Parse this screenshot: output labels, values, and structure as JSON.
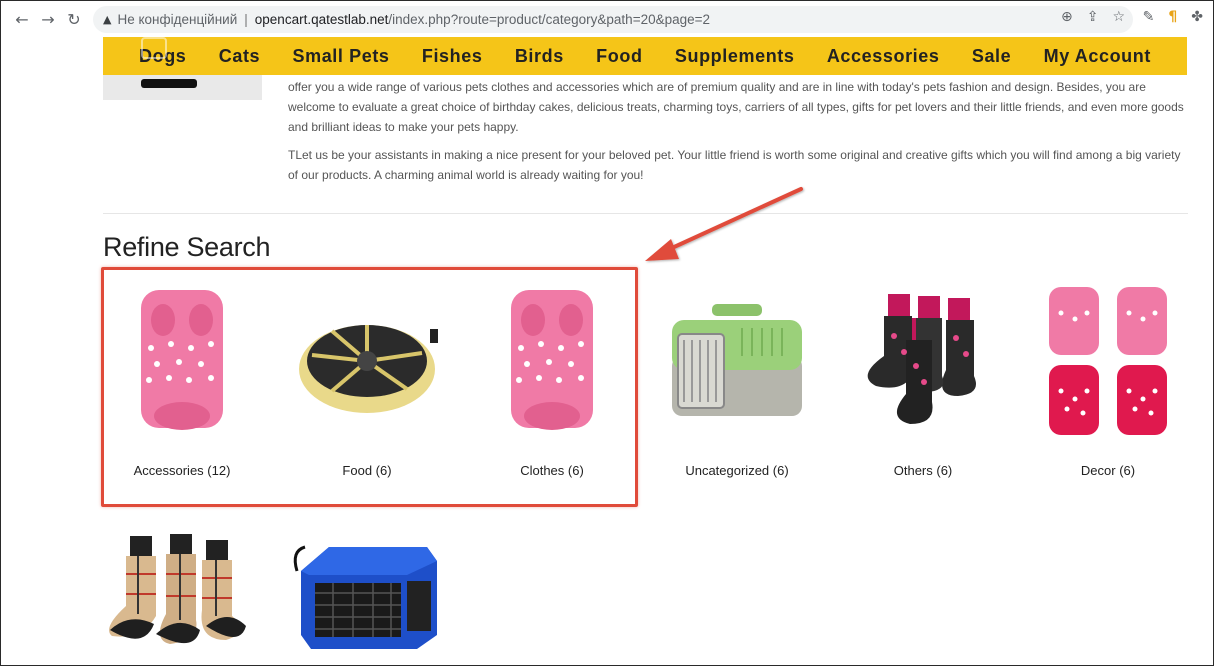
{
  "browser": {
    "security_text": "Не конфіденційний",
    "separator": "|",
    "url_host": "opencart.qatestlab.net",
    "url_path": "/index.php?route=product/category&path=20&page=2"
  },
  "site_nav": {
    "items": [
      "Dogs",
      "Cats",
      "Small Pets",
      "Fishes",
      "Birds",
      "Food",
      "Supplements",
      "Accessories",
      "Sale",
      "My Account"
    ]
  },
  "description": {
    "p1": "offer you a wide range of various pets clothes and accessories which are of premium quality and are in line with today's pets fashion and design. Besides, you are welcome to evaluate a great choice of birthday cakes, delicious treats, charming toys, carriers of all types, gifts for pet lovers and their little friends, and even more goods and brilliant ideas to make your pets happy.",
    "p2": "TLet us be your assistants in making a nice present for your beloved pet. Your little friend is worth some original and creative gifts which you will find among a big variety of our products. A charming animal world is already waiting for you!"
  },
  "refine": {
    "title": "Refine Search",
    "categories": [
      {
        "label": "Accessories (12)",
        "icon": "pink-sweater-icon"
      },
      {
        "label": "Food (6)",
        "icon": "pet-feeder-bowl-icon"
      },
      {
        "label": "Clothes (6)",
        "icon": "pink-sweater-icon"
      },
      {
        "label": "Uncategorized (6)",
        "icon": "pet-carrier-icon"
      },
      {
        "label": "Others (6)",
        "icon": "pet-boots-icon"
      },
      {
        "label": "Decor (6)",
        "icon": "sweater-set-icon"
      }
    ],
    "row2": [
      {
        "icon": "plaid-boots-icon"
      },
      {
        "icon": "blue-soft-carrier-icon"
      }
    ]
  },
  "colors": {
    "nav_bg": "#f5c518",
    "annotation": "#e04b3a",
    "sweater_pink": "#f07aa6"
  }
}
